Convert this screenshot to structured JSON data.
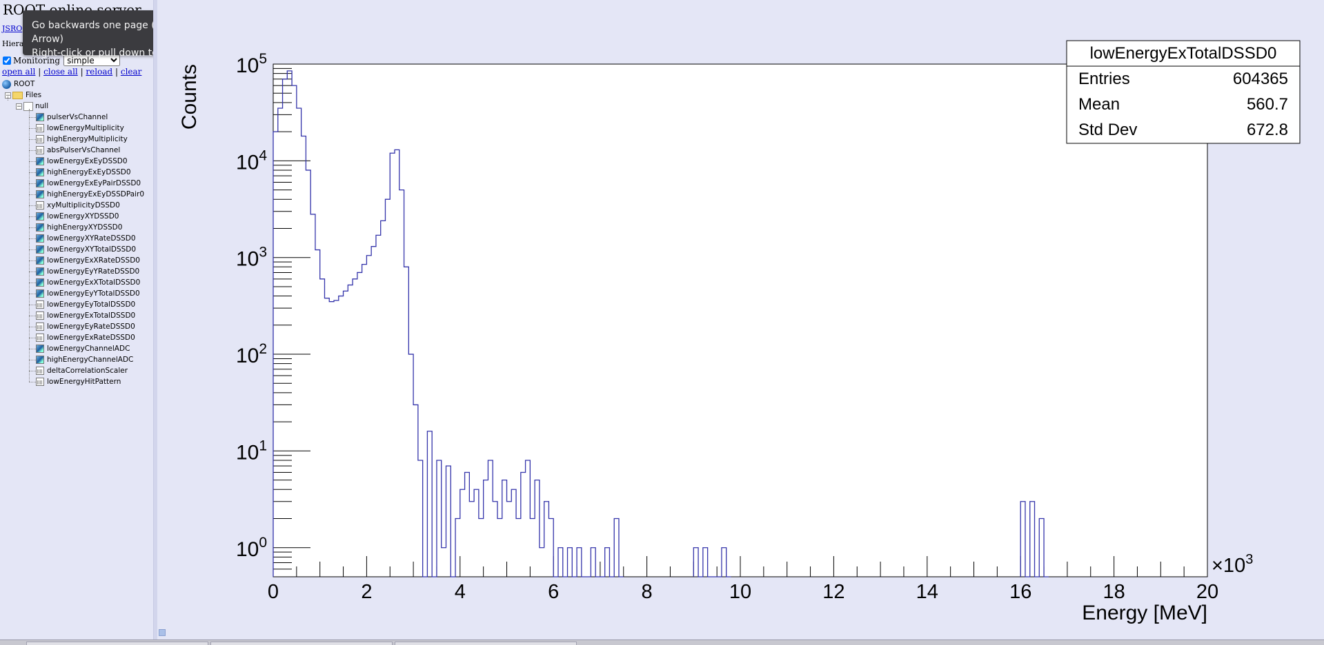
{
  "app": {
    "title": "ROOT online server",
    "jsroot_link": "JSRO",
    "hierarchy_label": "Hierar",
    "monitoring_label": "Monitoring",
    "monitoring_checked": true,
    "monitoring_mode": "simple",
    "actions": [
      "open all",
      "close all",
      "reload",
      "clear"
    ]
  },
  "tooltip": {
    "line1": "Go backwards one page (Alt+Left Arrow)",
    "line2": "Right-click or pull down to show history"
  },
  "tree": {
    "root_label": "ROOT",
    "files_label": "Files",
    "file_label": "null",
    "items": [
      {
        "label": "pulserVsChannel",
        "type": "h2"
      },
      {
        "label": "lowEnergyMultiplicity",
        "type": "h1"
      },
      {
        "label": "highEnergyMultiplicity",
        "type": "h1"
      },
      {
        "label": "absPulserVsChannel",
        "type": "h1"
      },
      {
        "label": "lowEnergyExEyDSSD0",
        "type": "h2"
      },
      {
        "label": "highEnergyExEyDSSD0",
        "type": "h2"
      },
      {
        "label": "lowEnergyExEyPairDSSD0",
        "type": "h2"
      },
      {
        "label": "highEnergyExEyDSSDPair0",
        "type": "h2"
      },
      {
        "label": "xyMultiplicityDSSD0",
        "type": "h1"
      },
      {
        "label": "lowEnergyXYDSSD0",
        "type": "h2"
      },
      {
        "label": "highEnergyXYDSSD0",
        "type": "h2"
      },
      {
        "label": "lowEnergyXYRateDSSD0",
        "type": "h2"
      },
      {
        "label": "lowEnergyXYTotalDSSD0",
        "type": "h2"
      },
      {
        "label": "lowEnergyExXRateDSSD0",
        "type": "h2"
      },
      {
        "label": "lowEnergyEyYRateDSSD0",
        "type": "h2"
      },
      {
        "label": "lowEnergyExXTotalDSSD0",
        "type": "h2"
      },
      {
        "label": "lowEnergyEyYTotalDSSD0",
        "type": "h2"
      },
      {
        "label": "lowEnergyEyTotalDSSD0",
        "type": "h1"
      },
      {
        "label": "lowEnergyExTotalDSSD0",
        "type": "h1"
      },
      {
        "label": "lowEnergyEyRateDSSD0",
        "type": "h1"
      },
      {
        "label": "lowEnergyExRateDSSD0",
        "type": "h1"
      },
      {
        "label": "lowEnergyChannelADC",
        "type": "h2"
      },
      {
        "label": "highEnergyChannelADC",
        "type": "h2"
      },
      {
        "label": "deltaCorrelationScaler",
        "type": "h1"
      },
      {
        "label": "lowEnergyHitPattern",
        "type": "h1"
      }
    ]
  },
  "colors": {
    "line": "#3333aa",
    "frame_bg": "#ffffff",
    "page_bg": "#e4e6f6"
  },
  "chart_data": {
    "type": "histogram",
    "stats": {
      "name": "lowEnergyExTotalDSSD0",
      "entries_label": "Entries",
      "entries": "604365",
      "mean_label": "Mean",
      "mean": "560.7",
      "stddev_label": "Std Dev",
      "stddev": "672.8"
    },
    "xlabel": "Energy [MeV]",
    "ylabel": "Counts",
    "x_multiplier": "×10",
    "x_multiplier_exp": "3",
    "xlim": [
      0,
      20
    ],
    "ylim": [
      0.5,
      100000
    ],
    "log_y": true,
    "grid": false,
    "x_ticks": [
      0,
      2,
      4,
      6,
      8,
      10,
      12,
      14,
      16,
      18,
      20
    ],
    "y_ticks": [
      {
        "base": "10",
        "exp": "0",
        "value": 1
      },
      {
        "base": "10",
        "exp": "1",
        "value": 10
      },
      {
        "base": "10",
        "exp": "2",
        "value": 100
      },
      {
        "base": "10",
        "exp": "3",
        "value": 1000
      },
      {
        "base": "10",
        "exp": "4",
        "value": 10000
      },
      {
        "base": "10",
        "exp": "5",
        "value": 100000
      }
    ],
    "bin_width": 0.1,
    "bins": [
      [
        0.0,
        20000
      ],
      [
        0.1,
        35000
      ],
      [
        0.2,
        70000
      ],
      [
        0.3,
        85000
      ],
      [
        0.4,
        60000
      ],
      [
        0.5,
        35000
      ],
      [
        0.6,
        18000
      ],
      [
        0.7,
        8000
      ],
      [
        0.8,
        2800
      ],
      [
        0.9,
        1200
      ],
      [
        1.0,
        600
      ],
      [
        1.1,
        380
      ],
      [
        1.2,
        350
      ],
      [
        1.3,
        360
      ],
      [
        1.4,
        400
      ],
      [
        1.5,
        450
      ],
      [
        1.6,
        520
      ],
      [
        1.7,
        600
      ],
      [
        1.8,
        700
      ],
      [
        1.9,
        850
      ],
      [
        2.0,
        1050
      ],
      [
        2.1,
        1300
      ],
      [
        2.2,
        1700
      ],
      [
        2.3,
        2400
      ],
      [
        2.4,
        4000
      ],
      [
        2.5,
        12000
      ],
      [
        2.6,
        13000
      ],
      [
        2.7,
        5000
      ],
      [
        2.8,
        800
      ],
      [
        2.9,
        100
      ],
      [
        3.0,
        30
      ],
      [
        3.1,
        8
      ],
      [
        3.2,
        0
      ],
      [
        3.3,
        16
      ],
      [
        3.4,
        0
      ],
      [
        3.5,
        8
      ],
      [
        3.6,
        1
      ],
      [
        3.7,
        7
      ],
      [
        3.8,
        0
      ],
      [
        3.9,
        2
      ],
      [
        4.0,
        4
      ],
      [
        4.1,
        6
      ],
      [
        4.2,
        3
      ],
      [
        4.3,
        4
      ],
      [
        4.4,
        2
      ],
      [
        4.5,
        5
      ],
      [
        4.6,
        8
      ],
      [
        4.7,
        3
      ],
      [
        4.8,
        2
      ],
      [
        4.9,
        5
      ],
      [
        5.0,
        3
      ],
      [
        5.1,
        4
      ],
      [
        5.2,
        2
      ],
      [
        5.3,
        6
      ],
      [
        5.4,
        8
      ],
      [
        5.5,
        2
      ],
      [
        5.6,
        5
      ],
      [
        5.7,
        1
      ],
      [
        5.8,
        3
      ],
      [
        5.9,
        2
      ],
      [
        6.0,
        0
      ],
      [
        6.1,
        1
      ],
      [
        6.2,
        0
      ],
      [
        6.3,
        1
      ],
      [
        6.4,
        0
      ],
      [
        6.5,
        1
      ],
      [
        6.6,
        0
      ],
      [
        6.7,
        0
      ],
      [
        6.8,
        1
      ],
      [
        6.9,
        0
      ],
      [
        7.0,
        0
      ],
      [
        7.1,
        1
      ],
      [
        7.2,
        0
      ],
      [
        7.3,
        2
      ],
      [
        7.4,
        0
      ],
      [
        9.0,
        1
      ],
      [
        9.1,
        0
      ],
      [
        9.2,
        1
      ],
      [
        9.3,
        0
      ],
      [
        9.4,
        0
      ],
      [
        9.5,
        0
      ],
      [
        9.6,
        1
      ],
      [
        9.7,
        0
      ],
      [
        16.0,
        3
      ],
      [
        16.1,
        0
      ],
      [
        16.2,
        3
      ],
      [
        16.3,
        0
      ],
      [
        16.4,
        2
      ],
      [
        16.5,
        0
      ]
    ]
  }
}
